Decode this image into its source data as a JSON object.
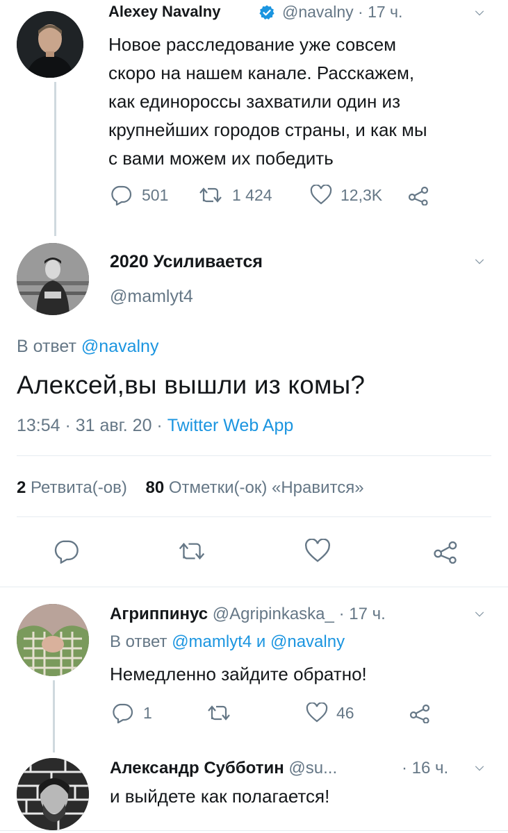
{
  "tweet1": {
    "name": "Alexey Navalny",
    "handle": "@navalny",
    "time": "· 17 ч.",
    "text_lines": [
      "Новое расследование уже совсем",
      "скоро на нашем канале. Расскажем,",
      "как единороссы захватили один из",
      "крупнейших городов страны, и как мы",
      "с вами можем их победить"
    ],
    "replies": "501",
    "retweets": "1 424",
    "likes": "12,3K"
  },
  "main": {
    "name": "2020 Усиливается",
    "handle": "@mamlyt4",
    "reply_prefix": "В ответ",
    "reply_to": "@navalny",
    "text": "Алексей,вы вышли из комы?",
    "time": "13:54 · 31 авг. 20 ·",
    "source": "Twitter Web App",
    "retweets_count": "2",
    "retweets_label": "Ретвита(-ов)",
    "likes_count": "80",
    "likes_label": "Отметки(-ок) «Нравится»"
  },
  "reply1": {
    "name": "Агриппинус",
    "handle": "@Agripinkaska_",
    "time": "· 17 ч.",
    "reply_prefix": "В ответ",
    "reply_to_1": "@mamlyt4",
    "reply_and": "и",
    "reply_to_2": "@navalny",
    "text": "Немедленно зайдите обратно!",
    "replies": "1",
    "likes": "46"
  },
  "reply2": {
    "name": "Александр Субботин",
    "handle": "@su...",
    "time": "· 16 ч.",
    "text": "и выйдете как полагается!"
  },
  "colors": {
    "accent": "#1b95e0",
    "muted": "#657786",
    "text": "#14171a",
    "line": "#cfd9de"
  }
}
